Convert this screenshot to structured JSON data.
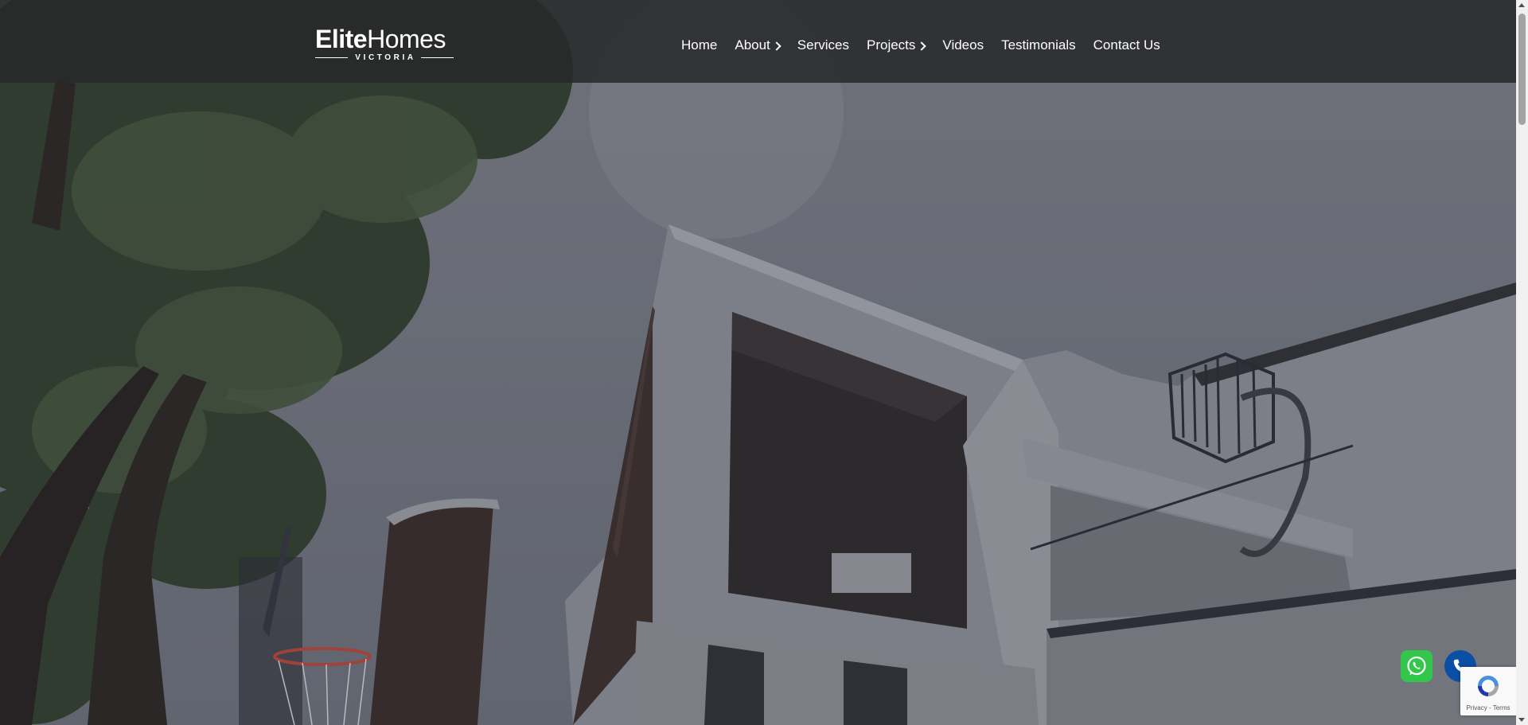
{
  "brand": {
    "name_bold": "Elite",
    "name_regular": "Homes",
    "subtitle": "VICTORIA"
  },
  "nav": {
    "items": [
      {
        "label": "Home",
        "has_dropdown": false
      },
      {
        "label": "About",
        "has_dropdown": true
      },
      {
        "label": "Services",
        "has_dropdown": false
      },
      {
        "label": "Projects",
        "has_dropdown": true
      },
      {
        "label": "Videos",
        "has_dropdown": false
      },
      {
        "label": "Testimonials",
        "has_dropdown": false
      },
      {
        "label": "Contact Us",
        "has_dropdown": false
      }
    ]
  },
  "floating": {
    "whatsapp_icon": "whatsapp-icon",
    "phone_icon": "phone-icon"
  },
  "recaptcha": {
    "links": "Privacy - Terms"
  },
  "colors": {
    "header_bg": "#28282a",
    "whatsapp_green": "#32c64b",
    "phone_blue": "#0a4fa3"
  }
}
